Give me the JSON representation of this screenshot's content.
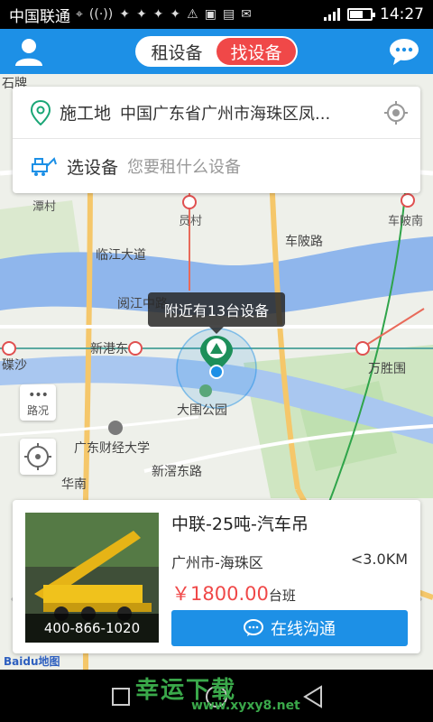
{
  "status": {
    "carrier": "中国联通",
    "time": "14:27",
    "icons": [
      "location-icon",
      "hotspot-icon",
      "wechat-icon",
      "wechat-icon",
      "wechat-icon",
      "wechat-icon",
      "warning-icon",
      "image-icon",
      "keyboard-icon",
      "mail-icon"
    ]
  },
  "header": {
    "tabs": [
      {
        "label": "租设备",
        "active": false
      },
      {
        "label": "找设备",
        "active": true
      }
    ]
  },
  "search": {
    "site_label": "施工地",
    "site_value": "中国广东省广州市海珠区凤...",
    "equip_label": "选设备",
    "equip_placeholder": "您要租什么设备"
  },
  "map": {
    "labels": {
      "tan_cun": "潭村",
      "yuan_cun": "员村",
      "che_bei_nan": "车陂南",
      "lin_jiang": "临江大道",
      "che_bei_lu": "车陂路",
      "yue_jiang": "阅江中路",
      "xin_gang_dong": "新港东",
      "die_sha": "碟沙",
      "wan_sheng_wei": "万胜围",
      "da_wei_park": "大围公园",
      "guang_dong_cj": "广东财经大学",
      "xin_jiao_dong": "新滘东路",
      "shi_pai": "石牌",
      "hua_nan": "华南"
    },
    "tooltip": "附近有13台设备",
    "traffic_label": "路况",
    "baidu": "Baidu地图"
  },
  "card": {
    "name": "中联-25吨-汽车吊",
    "city": "广州市-海珠区",
    "distance": "<3.0KM",
    "price": "￥1800.00",
    "unit": "台班",
    "phone": "400-866-1020",
    "action": "在线沟通"
  },
  "watermark": {
    "main": "幸运下载",
    "url": "www.xyxy8.net"
  },
  "colors": {
    "primary": "#1d90e6",
    "accent": "#f04848",
    "river": "#8fb6ec"
  }
}
